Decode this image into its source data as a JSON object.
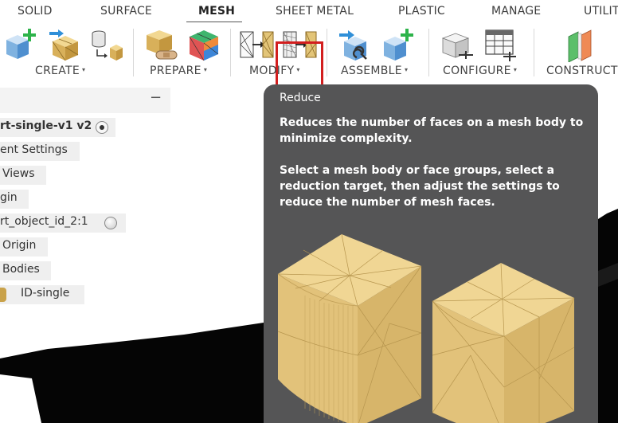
{
  "tabs": [
    {
      "label": "SOLID"
    },
    {
      "label": "SURFACE"
    },
    {
      "label": "MESH"
    },
    {
      "label": "SHEET METAL"
    },
    {
      "label": "PLASTIC"
    },
    {
      "label": "MANAGE"
    },
    {
      "label": "UTILITIES"
    }
  ],
  "toolbar": {
    "groups": [
      {
        "label": "CREATE"
      },
      {
        "label": "PREPARE"
      },
      {
        "label": "MODIFY"
      },
      {
        "label": "ASSEMBLE"
      },
      {
        "label": "CONFIGURE"
      },
      {
        "label": "CONSTRUCT"
      }
    ],
    "caret": "▾"
  },
  "browser": {
    "collapse_glyph": "−",
    "nodes": [
      {
        "label": "rt-single-v1 v2"
      },
      {
        "label": "ent Settings"
      },
      {
        "label": "Views"
      },
      {
        "label": "gin"
      },
      {
        "label": "rt_object_id_2:1"
      },
      {
        "label": "Origin"
      },
      {
        "label": "Bodies"
      },
      {
        "label": "ID-single"
      }
    ]
  },
  "tooltip": {
    "title": "Reduce",
    "description": "Reduces the number of faces on a mesh body to minimize complexity.",
    "instructions": "Select a mesh body or face groups, select a reduction target, then adjust the settings to reduce the number of mesh faces."
  },
  "colors": {
    "accent_highlight": "#d21e1e",
    "tooltip_bg": "#555556",
    "mesh_gold": "#e8c97a",
    "icon_blue": "#2f8fd8",
    "icon_green": "#2db34a"
  }
}
